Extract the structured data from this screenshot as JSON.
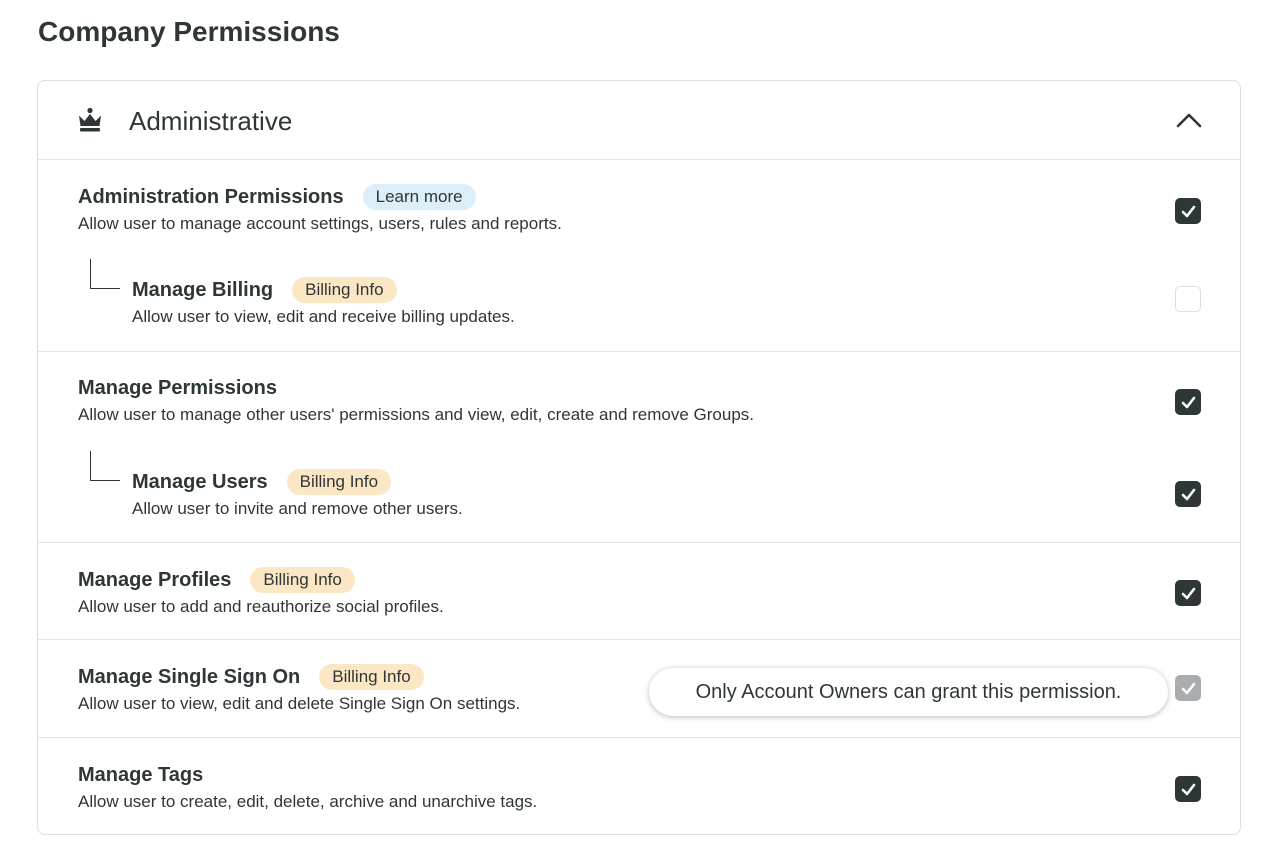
{
  "page": {
    "title": "Company Permissions"
  },
  "section": {
    "title": "Administrative",
    "icon": "crown-icon",
    "collapse_icon": "chevron-up-icon"
  },
  "permissions": [
    {
      "title": "Administration Permissions",
      "badge": "Learn more",
      "badge_type": "learn",
      "description": "Allow user to manage account settings, users, rules and reports.",
      "checked": true
    },
    {
      "title": "Manage Billing",
      "badge": "Billing Info",
      "badge_type": "billing",
      "description": "Allow user to view, edit and receive billing updates.",
      "checked": false,
      "child_of": "Administration Permissions"
    },
    {
      "title": "Manage Permissions",
      "badge": "",
      "description": "Allow user to manage other users' permissions and view, edit, create and remove Groups.",
      "checked": true
    },
    {
      "title": "Manage Users",
      "badge": "Billing Info",
      "badge_type": "billing",
      "description": "Allow user to invite and remove other users.",
      "checked": true,
      "child_of": "Manage Permissions"
    },
    {
      "title": "Manage Profiles",
      "badge": "Billing Info",
      "badge_type": "billing",
      "description": "Allow user to add and reauthorize social profiles.",
      "checked": true
    },
    {
      "title": "Manage Single Sign On",
      "badge": "Billing Info",
      "badge_type": "billing",
      "description": "Allow user to view, edit and delete Single Sign On settings.",
      "checked": true,
      "disabled": true
    },
    {
      "title": "Manage Tags",
      "badge": "",
      "description": "Allow user to create, edit, delete, archive and unarchive tags.",
      "checked": true
    }
  ],
  "tooltip": {
    "text": "Only Account Owners can grant this permission."
  },
  "colors": {
    "text": "#2f3638",
    "checkbox_checked": "#2f3638",
    "checkbox_disabled": "#a9adaf",
    "learn_badge_bg": "#dceef7",
    "billing_badge_bg": "#fbe7c4",
    "border": "#dcdedf"
  }
}
